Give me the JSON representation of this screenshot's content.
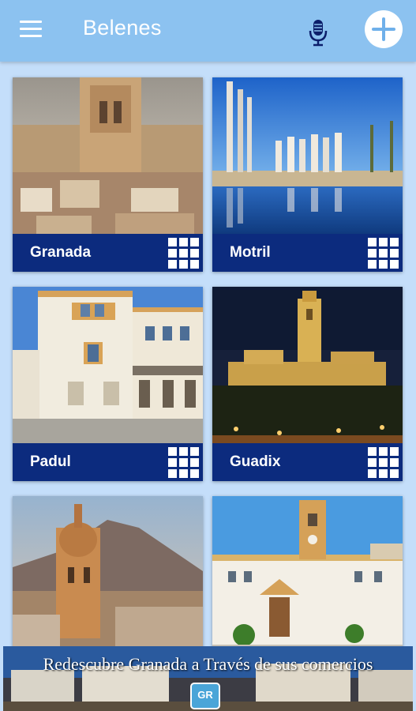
{
  "appbar": {
    "title": "Belenes",
    "menu_icon": "hamburger-menu-icon",
    "mic_icon": "microphone-icon",
    "add_icon": "plus-circle-icon"
  },
  "cards": [
    {
      "label": "Granada",
      "icon": "grid-icon"
    },
    {
      "label": "Motril",
      "icon": "grid-icon"
    },
    {
      "label": "Padul",
      "icon": "grid-icon"
    },
    {
      "label": "Guadix",
      "icon": "grid-icon"
    },
    {
      "label": "",
      "icon": ""
    },
    {
      "label": "",
      "icon": ""
    }
  ],
  "banner": {
    "text": "Redescubre Granada a Través de sus comercios",
    "logo": "GR"
  },
  "colors": {
    "appbar": "#8cc2f0",
    "background": "#c4defa",
    "card_label_bar": "#0c2b7e"
  }
}
